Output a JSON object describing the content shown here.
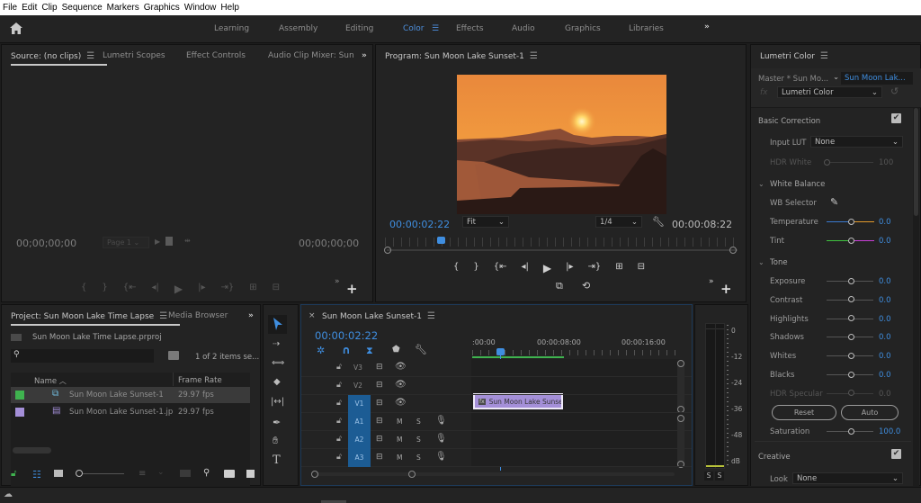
{
  "menu": [
    "File",
    "Edit",
    "Clip",
    "Sequence",
    "Markers",
    "Graphics",
    "Window",
    "Help"
  ],
  "workspaces": {
    "items": [
      "Learning",
      "Assembly",
      "Editing",
      "Color",
      "Effects",
      "Audio",
      "Graphics",
      "Libraries"
    ],
    "active": "Color",
    "overflow": "»"
  },
  "source_panel": {
    "tabs": [
      "Source: (no clips)",
      "Lumetri Scopes",
      "Effect Controls",
      "Audio Clip Mixer: Sun"
    ],
    "timecode_in": "00;00;00;00",
    "timecode_out": "00;00;00;00",
    "page_select": "Page 1"
  },
  "program_panel": {
    "title": "Program: Sun Moon Lake Sunset-1",
    "timecode": "00:00:02:22",
    "fit": "Fit",
    "resolution": "1/4",
    "duration": "00:00:08:22",
    "playhead_fraction": 0.155
  },
  "project_panel": {
    "tabs": [
      "Project: Sun Moon Lake Time Lapse",
      "Media Browser"
    ],
    "project_file": "Sun Moon Lake Time Lapse.prproj",
    "search_placeholder": "",
    "items_selected": "1 of 2 items se...",
    "columns": [
      "Name",
      "Frame Rate"
    ],
    "rows": [
      {
        "color": "#3fb34f",
        "icon": "sequence-icon",
        "name": "Sun Moon Lake Sunset-1",
        "frame_rate": "29.97 fps",
        "selected": true
      },
      {
        "color": "#a48fd8",
        "icon": "image-icon",
        "name": "Sun Moon Lake Sunset-1.jp",
        "frame_rate": "29.97 fps",
        "selected": false
      }
    ]
  },
  "timeline": {
    "title": "Sun Moon Lake Sunset-1",
    "timecode": "00:00:02:22",
    "ruler": [
      ":00:00",
      "00:00:08:00",
      "00:00:16:00"
    ],
    "video_tracks": [
      "V3",
      "V2",
      "V1"
    ],
    "audio_tracks": [
      "A1",
      "A2",
      "A3"
    ],
    "audio_buttons": {
      "mute": "M",
      "solo": "S"
    },
    "clip_label": "Sun Moon Lake Sunse",
    "clip_fx": "fx"
  },
  "audio_meter": {
    "scale": [
      "0",
      "-12",
      "-24",
      "-36",
      "-48",
      "dB"
    ],
    "solo_buttons": [
      "S",
      "S"
    ]
  },
  "lumetri": {
    "title": "Lumetri Color",
    "master": "Master * Sun Mo...",
    "clip": "Sun Moon Lak...",
    "effect": "Lumetri Color",
    "basic_correction": "Basic Correction",
    "input_lut_label": "Input LUT",
    "input_lut_value": "None",
    "hdr_white_label": "HDR White",
    "hdr_white_value": "100",
    "white_balance": "White Balance",
    "wb_selector": "WB Selector",
    "temperature_label": "Temperature",
    "temperature_value": "0.0",
    "tint_label": "Tint",
    "tint_value": "0.0",
    "tone": "Tone",
    "tone_controls": [
      {
        "label": "Exposure",
        "value": "0.0",
        "disabled": false
      },
      {
        "label": "Contrast",
        "value": "0.0",
        "disabled": false
      },
      {
        "label": "Highlights",
        "value": "0.0",
        "disabled": false
      },
      {
        "label": "Shadows",
        "value": "0.0",
        "disabled": false
      },
      {
        "label": "Whites",
        "value": "0.0",
        "disabled": false
      },
      {
        "label": "Blacks",
        "value": "0.0",
        "disabled": false
      },
      {
        "label": "HDR Specular",
        "value": "0.0",
        "disabled": true
      }
    ],
    "reset": "Reset",
    "auto": "Auto",
    "saturation_label": "Saturation",
    "saturation_value": "100.0",
    "creative": "Creative",
    "look_label": "Look",
    "look_value": "None"
  },
  "colors": {
    "accent": "#3f8ee0",
    "panel": "#232323",
    "bg": "#1d1d1d",
    "clip": "#a48fd8",
    "track_target": "#1c5c94"
  }
}
